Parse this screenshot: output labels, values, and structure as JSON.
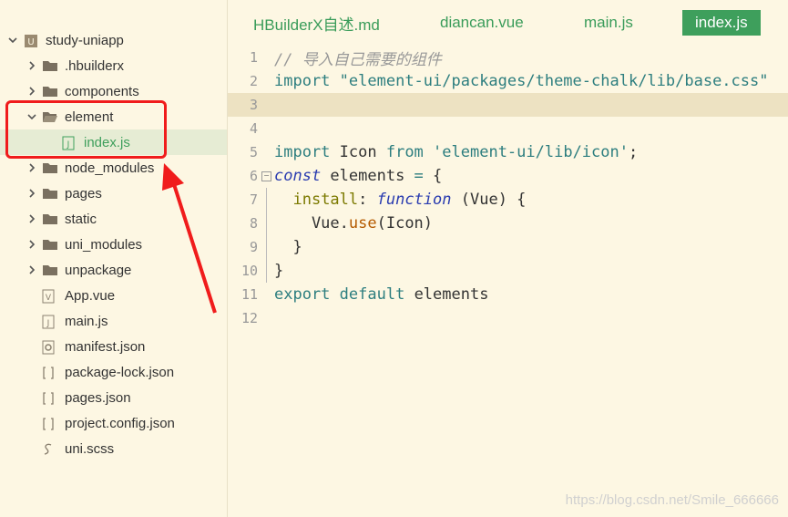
{
  "explorer": {
    "items": [
      {
        "label": "study-uniapp",
        "type": "project",
        "chevron": "down"
      },
      {
        "label": ".hbuilderx",
        "type": "folder",
        "chevron": "right"
      },
      {
        "label": "components",
        "type": "folder",
        "chevron": "right"
      },
      {
        "label": "element",
        "type": "folder-open",
        "chevron": "down"
      },
      {
        "label": "index.js",
        "type": "js-file",
        "selected": true
      },
      {
        "label": "node_modules",
        "type": "folder",
        "chevron": "right"
      },
      {
        "label": "pages",
        "type": "folder",
        "chevron": "right"
      },
      {
        "label": "static",
        "type": "folder",
        "chevron": "right"
      },
      {
        "label": "uni_modules",
        "type": "folder",
        "chevron": "right"
      },
      {
        "label": "unpackage",
        "type": "folder",
        "chevron": "right"
      },
      {
        "label": "App.vue",
        "type": "vue-file"
      },
      {
        "label": "main.js",
        "type": "js-file"
      },
      {
        "label": "manifest.json",
        "type": "manifest-file"
      },
      {
        "label": "package-lock.json",
        "type": "json-file"
      },
      {
        "label": "pages.json",
        "type": "json-file"
      },
      {
        "label": "project.config.json",
        "type": "json-file"
      },
      {
        "label": "uni.scss",
        "type": "scss-file"
      }
    ]
  },
  "tabs": [
    {
      "label": "HBuilderX自述.md",
      "active": false
    },
    {
      "label": "diancan.vue",
      "active": false
    },
    {
      "label": "main.js",
      "active": false
    },
    {
      "label": "index.js",
      "active": true
    }
  ],
  "code": {
    "line_numbers": [
      "1",
      "2",
      "3",
      "4",
      "5",
      "6",
      "7",
      "8",
      "9",
      "10",
      "11",
      "12"
    ],
    "lines": [
      [
        {
          "t": "// 导入自己需要的组件",
          "c": "cmt"
        }
      ],
      [
        {
          "t": "import",
          "c": "kw"
        },
        {
          "t": " ",
          "c": "plain"
        },
        {
          "t": "\"element-ui/packages/theme-chalk/lib/base.css\"",
          "c": "str"
        }
      ],
      [],
      [],
      [
        {
          "t": "import",
          "c": "kw"
        },
        {
          "t": " Icon ",
          "c": "plain"
        },
        {
          "t": "from",
          "c": "kw"
        },
        {
          "t": " ",
          "c": "plain"
        },
        {
          "t": "'element-ui/lib/icon'",
          "c": "str"
        },
        {
          "t": ";",
          "c": "plain"
        }
      ],
      [
        {
          "t": "const",
          "c": "fn"
        },
        {
          "t": " elements ",
          "c": "plain"
        },
        {
          "t": "=",
          "c": "kw"
        },
        {
          "t": " {",
          "c": "plain"
        }
      ],
      [
        {
          "t": "  ",
          "c": "plain"
        },
        {
          "t": "install",
          "c": "prop"
        },
        {
          "t": ": ",
          "c": "plain"
        },
        {
          "t": "function",
          "c": "fn"
        },
        {
          "t": " (Vue) {",
          "c": "plain"
        }
      ],
      [
        {
          "t": "    Vue.",
          "c": "plain"
        },
        {
          "t": "use",
          "c": "meth"
        },
        {
          "t": "(Icon)",
          "c": "plain"
        }
      ],
      [
        {
          "t": "  }",
          "c": "plain"
        }
      ],
      [
        {
          "t": "}",
          "c": "plain"
        }
      ],
      [
        {
          "t": "export",
          "c": "kw"
        },
        {
          "t": " ",
          "c": "plain"
        },
        {
          "t": "default",
          "c": "kw"
        },
        {
          "t": " elements",
          "c": "plain"
        }
      ],
      []
    ]
  },
  "watermark": "https://blog.csdn.net/Smile_666666",
  "colors": {
    "accent": "#3e9f5c",
    "annotation": "#f01c1c"
  }
}
